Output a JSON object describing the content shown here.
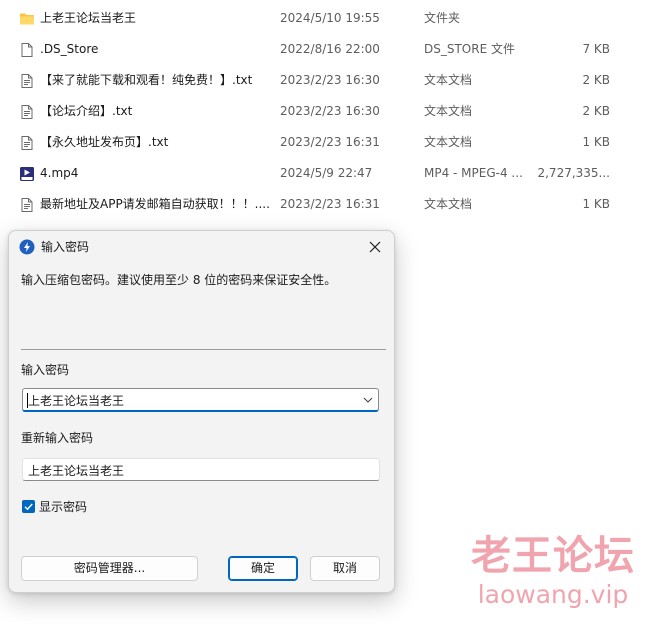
{
  "files": [
    {
      "name": "上老王论坛当老王",
      "date": "2024/5/10 19:55",
      "type": "文件夹",
      "size": "",
      "icon": "folder-icon"
    },
    {
      "name": ".DS_Store",
      "date": "2022/8/16 22:00",
      "type": "DS_STORE 文件",
      "size": "7 KB",
      "icon": "file-icon"
    },
    {
      "name": "【来了就能下载和观看！纯免费！】.txt",
      "date": "2023/2/23 16:30",
      "type": "文本文档",
      "size": "2 KB",
      "icon": "text-file-icon"
    },
    {
      "name": "【论坛介绍】.txt",
      "date": "2023/2/23 16:30",
      "type": "文本文档",
      "size": "2 KB",
      "icon": "text-file-icon"
    },
    {
      "name": "【永久地址发布页】.txt",
      "date": "2023/2/23 16:31",
      "type": "文本文档",
      "size": "1 KB",
      "icon": "text-file-icon"
    },
    {
      "name": "4.mp4",
      "date": "2024/5/9 22:47",
      "type": "MP4 - MPEG-4 ...",
      "size": "2,727,335...",
      "icon": "video-file-icon"
    },
    {
      "name": "最新地址及APP请发邮箱自动获取！！！....",
      "date": "2023/2/23 16:31",
      "type": "文本文档",
      "size": "1 KB",
      "icon": "text-file-icon"
    }
  ],
  "dialog": {
    "title": "输入密码",
    "description": "输入压缩包密码。建议使用至少 8 位的密码来保证安全性。",
    "password_label": "输入密码",
    "password_value": "上老王论坛当老王",
    "confirm_label": "重新输入密码",
    "confirm_value": "上老王论坛当老王",
    "show_password_label": "显示密码",
    "show_password_checked": true,
    "buttons": {
      "manager": "密码管理器...",
      "ok": "确定",
      "cancel": "取消"
    }
  },
  "watermark": {
    "chinese": "老王论坛",
    "domain": "laowang.vip"
  },
  "colors": {
    "accent": "#0067c0",
    "watermark": "#f0a5ae",
    "folder": "#f8c445"
  }
}
